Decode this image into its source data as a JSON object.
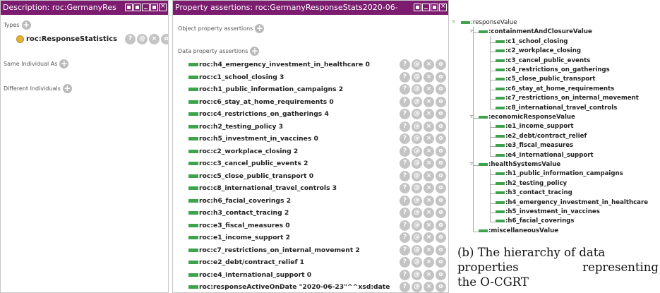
{
  "description_panel": {
    "title": "Description: roc:GermanyRes",
    "types_label": "Types",
    "type_value": "roc:ResponseStatistics",
    "same_individual_label": "Same Individual As",
    "different_individuals_label": "Different Individuals"
  },
  "property_panel": {
    "title": "Property assertions: roc:GermanyResponseStats2020-06-",
    "object_label": "Object property assertions",
    "data_label": "Data property assertions",
    "assertions": [
      "roc:h4_emergency_investment_in_healthcare  0",
      "roc:c1_school_closing  3",
      "roc:h1_public_information_campaigns  2",
      "roc:c6_stay_at_home_requirements  0",
      "roc:c4_restrictions_on_gatherings  4",
      "roc:h2_testing_policy  3",
      "roc:h5_investment_in_vaccines  0",
      "roc:c2_workplace_closing  2",
      "roc:c3_cancel_public_events  2",
      "roc:c5_close_public_transport  0",
      "roc:c8_international_travel_controls  3",
      "roc:h6_facial_coverings  2",
      "roc:h3_contact_tracing  2",
      "roc:e3_fiscal_measures  0",
      "roc:e1_income_support  2",
      "roc:c7_restrictions_on_internal_movement  2",
      "roc:e2_debt/contract_relief  1",
      "roc:e4_international_support  0",
      "roc:responseActiveOnDate  \"2020-06-23\"^^xsd:date"
    ]
  },
  "hierarchy": {
    "root": ":responseValue",
    "groups": [
      {
        "name": ":containmentAndClosureValue",
        "children": [
          ":c1_school_closing",
          ":c2_workplace_closing",
          ":c3_cancel_public_events",
          ":c4_restrictions_on_gatherings",
          ":c5_close_public_transport",
          ":c6_stay_at_home_requirements",
          ":c7_restrictions_on_internal_movement",
          ":c8_international_travel_controls"
        ]
      },
      {
        "name": ":economicResponseValue",
        "children": [
          ":e1_income_support",
          ":e2_debt/contract_relief",
          ":e3_fiscal_measures",
          ":e4_international_support"
        ]
      },
      {
        "name": ":healthSystemsValue",
        "children": [
          ":h1_public_information_campaigns",
          ":h2_testing_policy",
          ":h3_contact_tracing",
          ":h4_emergency_investment_in_healthcare",
          ":h5_investment_in_vaccines",
          ":h6_facial_coverings"
        ]
      },
      {
        "name": ":miscellaneousValue",
        "children": []
      }
    ]
  },
  "caption": {
    "line1": "(b) The hierarchy of data",
    "line2a": "properties",
    "line2b": "representing",
    "line3": "the O-CGRT"
  },
  "colors": {
    "header": "#7b1c6f",
    "property": "#3fa34d",
    "class": "#e2b23b"
  },
  "icons": [
    "add-icon",
    "class-icon",
    "data-property-icon",
    "help-icon",
    "annotate-icon",
    "delete-icon",
    "edit-icon"
  ]
}
